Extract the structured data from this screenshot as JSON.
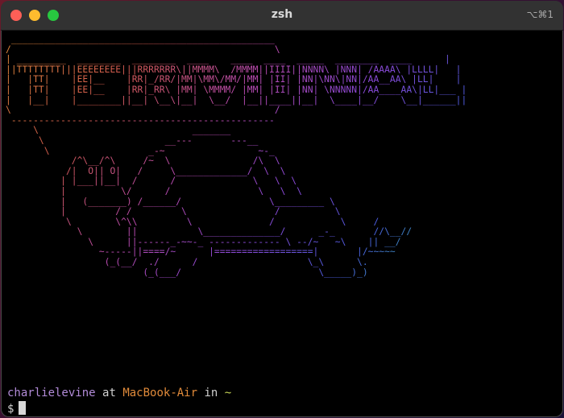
{
  "window": {
    "title": "zsh",
    "shortcut": "⌥⌘1"
  },
  "colors": {
    "orange": "#e0893a",
    "red": "#d25a4e",
    "magenta": "#b94bb0",
    "purple": "#8a4ad8",
    "blue": "#4a5ee0",
    "teal": "#2fae9a",
    "green": "#3fbf55"
  },
  "ascii_art": [
    " ________________________________________________",
    "/                                                \\",
    "| _________  ________  ________  ____    ____  ____  _____  ________  ____      |",
    "||TTTTTTTT|||EEEEEEEE|||RRRRRRR\\||MMMM\\  /MMMM||IIII||NNNN\\ |NNN| /AAAA\\ |LLLL|   |",
    "|   |TT|    |EE|__    |RR|_/RR/|MM|\\MM\\/MM/|MM| |II| |NN|\\NN\\|NN|/AA__AA\\ |LL|    |",
    "|   |TT|    |EE|__    |RR|_RR\\ |MM| \\MMMM/ |MM| |II| |NN| \\NNNNN|/AA____AA\\|LL|___ |",
    "|   |__|    |________||__| \\__\\|__|  \\__/  |__||____||__|  \\____|__/    \\__|______||",
    "\\                                                /",
    " ------------------------------------------------",
    "     \\                            _______",
    "      \\                      __---       ---__",
    "       \\                  _-~                 ~-_",
    "            /^\\__/^\\     /~  \\               /\\  \\",
    "           /|  O|| O|   /     \\_____________/  \\  \\",
    "          | |___||__|  /      /              \\   \\  \\",
    "          |          \\/      /                \\   \\  \\",
    "          |   (_______) /______/                \\_________ \\",
    "          |         / /         \\                /          \\",
    "           \\        \\^\\\\         \\              /            \\     /",
    "             \\        ||           \\______________/      _-_       //\\__//",
    "               \\      ||------_-~~-_ ------------- \\ --/~   ~\\    || __/",
    "                 ~-----||====/~      |==================|       |/~~~~~",
    "                  (_(__/  ./      /                    \\_\\      \\.",
    "                         (_(___/                         \\_____)_)"
  ],
  "prompt": {
    "user": "charlielevine",
    "at": "at",
    "host": "MacBook-Air",
    "in": "in",
    "dir": "~",
    "symbol": "$"
  }
}
